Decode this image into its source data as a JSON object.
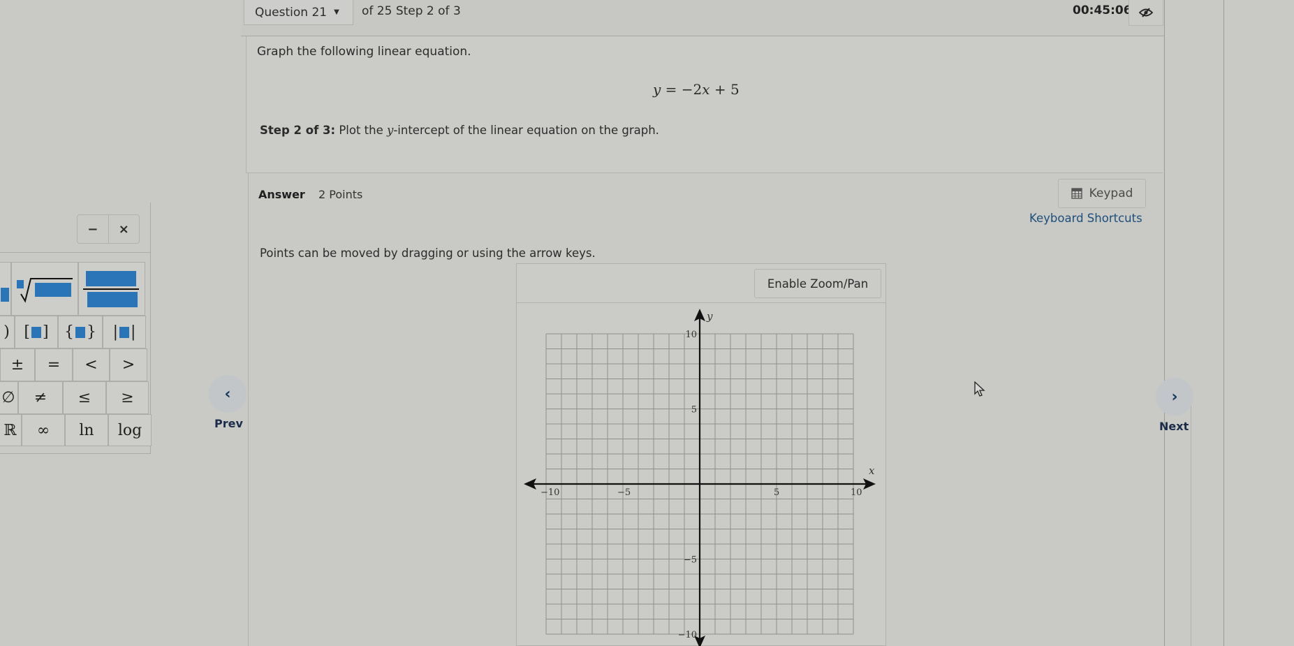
{
  "header": {
    "question_label": "Question 21",
    "step_text": "of 25 Step 2 of 3",
    "timer": "00:45:06",
    "timer_toggle_icon": "eye-slash-icon"
  },
  "question": {
    "prompt": "Graph the following linear equation.",
    "equation": {
      "lhs": "y",
      "eq": " = −2",
      "var": "x",
      "rest": " + 5"
    },
    "step_bold": "Step 2 of 3:",
    "step_pre": " Plot the ",
    "step_var": "y",
    "step_post": "-intercept of the linear equation on the graph."
  },
  "answer": {
    "label": "Answer",
    "points": "2 Points",
    "keypad_label": "Keypad",
    "keypad_icon": "calculator-icon",
    "keyboard_shortcuts": "Keyboard Shortcuts",
    "note": "Points can be moved by dragging or using the arrow keys.",
    "zoom_button": "Enable Zoom/Pan"
  },
  "keypad": {
    "minimize": "−",
    "close": "×",
    "row3": [
      "±",
      "=",
      "<",
      ">"
    ],
    "row4": [
      "≠",
      "≤",
      "≥"
    ],
    "row5": [
      "∞",
      "ln",
      "log"
    ]
  },
  "nav": {
    "prev_label": "Prev",
    "prev_icon": "‹",
    "next_label": "Next",
    "next_icon": "›"
  },
  "chart_data": {
    "type": "scatter",
    "title": "",
    "xlabel": "x",
    "ylabel": "y",
    "xlim": [
      -10,
      10
    ],
    "ylim": [
      -10,
      10
    ],
    "grid": true,
    "grid_step": 1,
    "x_tick_labels": [
      "−10",
      "−5",
      "5",
      "10"
    ],
    "x_ticks": [
      -10,
      -5,
      5,
      10
    ],
    "y_tick_labels": [
      "10",
      "5",
      "−5",
      "−10"
    ],
    "y_ticks": [
      10,
      5,
      -5,
      -10
    ],
    "points": []
  }
}
